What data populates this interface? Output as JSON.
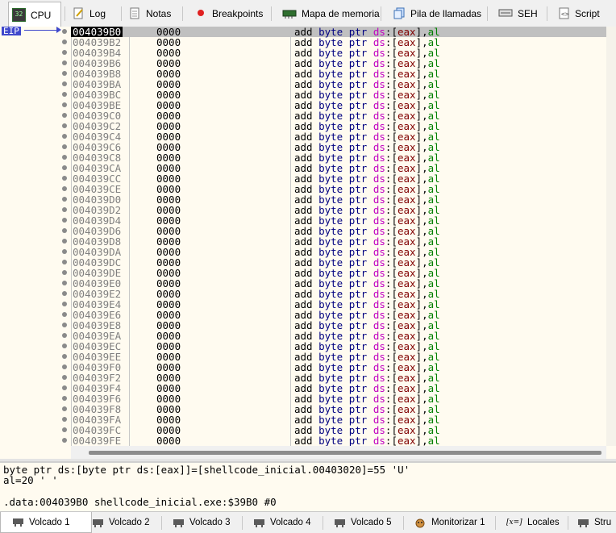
{
  "top_tabs": [
    {
      "label": "CPU",
      "icon": "cpu-icon"
    },
    {
      "label": "Log",
      "icon": "log-icon"
    },
    {
      "label": "Notas",
      "icon": "notes-icon"
    },
    {
      "label": "Breakpoints",
      "icon": "breakpoint-icon"
    },
    {
      "label": "Mapa de memoria",
      "icon": "memory-map-icon"
    },
    {
      "label": "Pila de llamadas",
      "icon": "call-stack-icon"
    },
    {
      "label": "SEH",
      "icon": "seh-icon"
    },
    {
      "label": "Script",
      "icon": "script-icon"
    }
  ],
  "cpu_icon_text": "32",
  "eip_label": "EIP",
  "disasm": {
    "selected_address": "004039B0",
    "addresses": [
      "004039B0",
      "004039B2",
      "004039B4",
      "004039B6",
      "004039B8",
      "004039BA",
      "004039BC",
      "004039BE",
      "004039C0",
      "004039C2",
      "004039C4",
      "004039C6",
      "004039C8",
      "004039CA",
      "004039CC",
      "004039CE",
      "004039D0",
      "004039D2",
      "004039D4",
      "004039D6",
      "004039D8",
      "004039DA",
      "004039DC",
      "004039DE",
      "004039E0",
      "004039E2",
      "004039E4",
      "004039E6",
      "004039E8",
      "004039EA",
      "004039EC",
      "004039EE",
      "004039F0",
      "004039F2",
      "004039F4",
      "004039F6",
      "004039F8",
      "004039FA",
      "004039FC",
      "004039FE"
    ],
    "bytes": "0000",
    "ins_mnemonic": "add",
    "ins_size": "byte",
    "ins_ptr": "ptr",
    "ins_seg": "ds",
    "ins_colon": ":",
    "ins_lbr": "[",
    "ins_reg": "eax",
    "ins_rbr": "]",
    "ins_comma": ",",
    "ins_src": "al"
  },
  "info": {
    "line1": "byte ptr ds:[byte ptr ds:[eax]]=[shellcode_inicial.00403020]=55 'U'",
    "line2": "al=20 ' '",
    "line3": "",
    "line4": ".data:004039B0 shellcode_inicial.exe:$39B0 #0"
  },
  "bottom_tabs": [
    {
      "label": "Volcado 1",
      "icon": "dump-icon"
    },
    {
      "label": "Volcado 2",
      "icon": "dump-icon"
    },
    {
      "label": "Volcado 3",
      "icon": "dump-icon"
    },
    {
      "label": "Volcado 4",
      "icon": "dump-icon"
    },
    {
      "label": "Volcado 5",
      "icon": "dump-icon"
    },
    {
      "label": "Monitorizar 1",
      "icon": "watch-icon"
    },
    {
      "label": "Locales",
      "icon": "locals-icon"
    },
    {
      "label": "Stru",
      "icon": "struct-icon"
    }
  ],
  "locals_icon_text": "[x=]"
}
